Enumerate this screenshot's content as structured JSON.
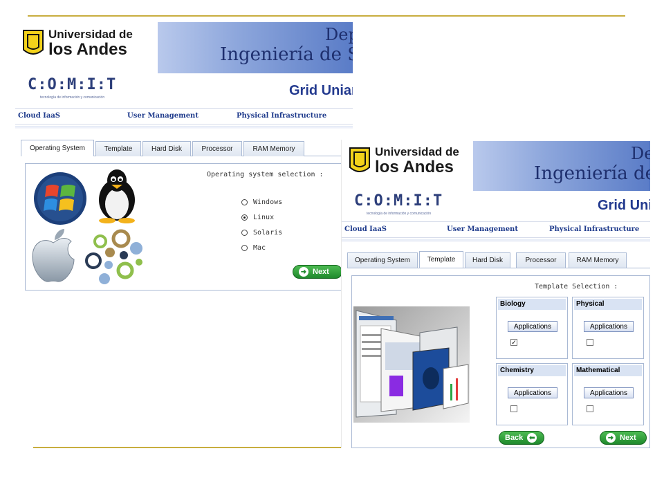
{
  "banner": {
    "university_line1": "Universidad de",
    "university_line2": "los Andes",
    "dept_fragment_left": "Dep",
    "engineering_fragment_left": "Ingeniería de S",
    "dept_fragment_right": "De",
    "engineering_fragment_right": "Ingeniería de",
    "comit_logo": "C:O:M:I:T",
    "comit_tagline": "tecnología de información y comunicación",
    "grid_fragment_left": "Grid Uniar",
    "grid_fragment_right": "Grid Unia"
  },
  "menu": {
    "cloud": "Cloud IaaS",
    "users": "User Management",
    "infra": "Physical Infrastructure"
  },
  "tabs": [
    "Operating System",
    "Template",
    "Hard Disk",
    "Processor",
    "RAM Memory"
  ],
  "os_panel": {
    "heading": "Operating system selection :",
    "options": [
      "Windows",
      "Linux",
      "Solaris",
      "Mac"
    ],
    "selected": "Linux",
    "next_label": "Next"
  },
  "template_panel": {
    "heading": "Template Selection :",
    "templates": [
      {
        "name": "Biology",
        "button": "Applications",
        "checked": true
      },
      {
        "name": "Physical",
        "button": "Applications",
        "checked": false
      },
      {
        "name": "Chemistry",
        "button": "Applications",
        "checked": false
      },
      {
        "name": "Mathematical",
        "button": "Applications",
        "checked": false
      }
    ],
    "back_label": "Back",
    "next_label": "Next"
  },
  "colors": {
    "accent_gold": "#c8ad3e",
    "banner_blue": "#5a7cc7",
    "menu_text": "#1f3b8c",
    "green_button": "#1f8a2d"
  }
}
